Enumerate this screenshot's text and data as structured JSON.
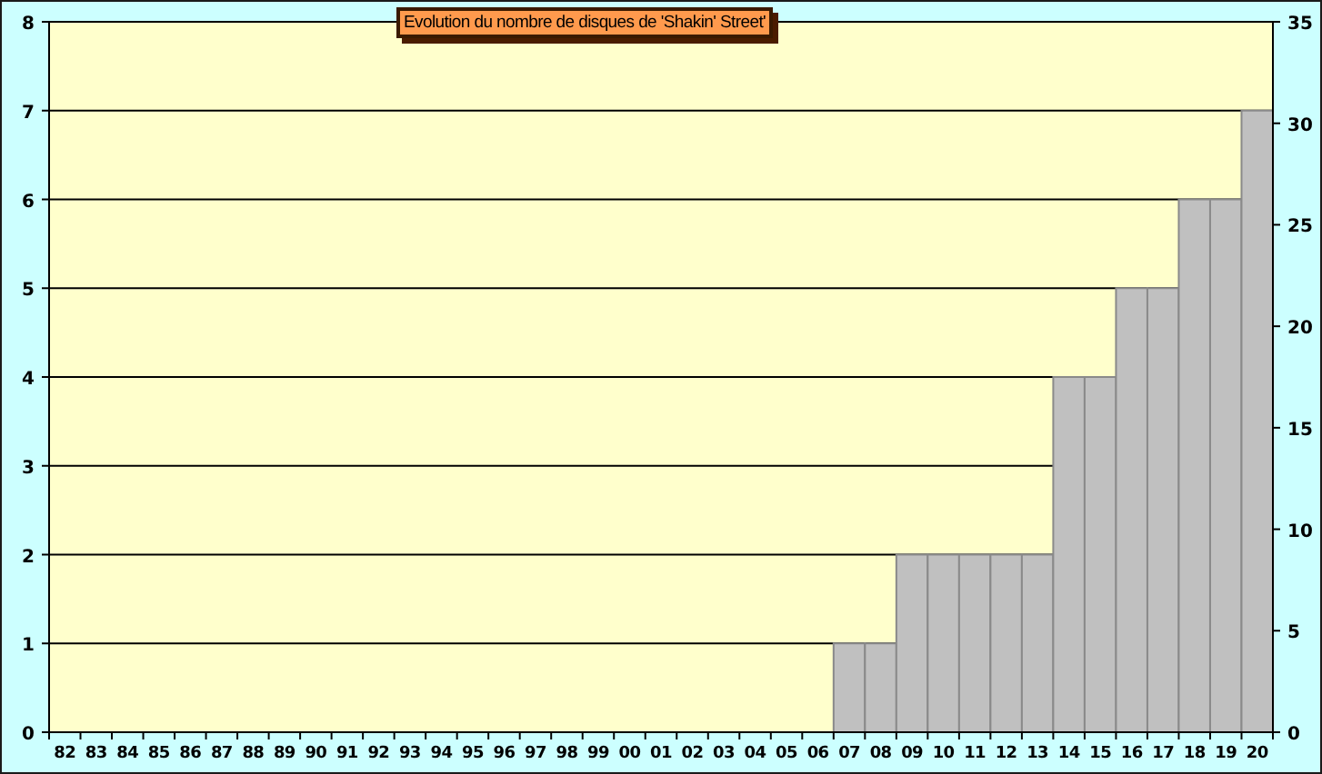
{
  "chart_data": {
    "type": "bar",
    "title": "Evolution du nombre de disques de 'Shakin' Street'",
    "categories": [
      "82",
      "83",
      "84",
      "85",
      "86",
      "87",
      "88",
      "89",
      "90",
      "91",
      "92",
      "93",
      "94",
      "95",
      "96",
      "97",
      "98",
      "99",
      "00",
      "01",
      "02",
      "03",
      "04",
      "05",
      "06",
      "07",
      "08",
      "09",
      "10",
      "11",
      "12",
      "13",
      "14",
      "15",
      "16",
      "17",
      "18",
      "19",
      "20"
    ],
    "grid": true,
    "series": [
      {
        "color": "#c0c0c0",
        "values": [
          0,
          0,
          0,
          0,
          0,
          0,
          0,
          0,
          0,
          0,
          0,
          0,
          0,
          0,
          0,
          0,
          0,
          0,
          0,
          0,
          0,
          0,
          0,
          0,
          0,
          1,
          1,
          2,
          2,
          2,
          2,
          2,
          4,
          4,
          5,
          5,
          6,
          6,
          7
        ]
      }
    ],
    "ylim": [
      0,
      8
    ],
    "yticks": [
      0,
      1,
      2,
      3,
      4,
      5,
      6,
      7,
      8
    ],
    "y2lim": [
      0,
      35
    ],
    "y2ticks": [
      0,
      5,
      10,
      15,
      20,
      25,
      30,
      35
    ]
  }
}
